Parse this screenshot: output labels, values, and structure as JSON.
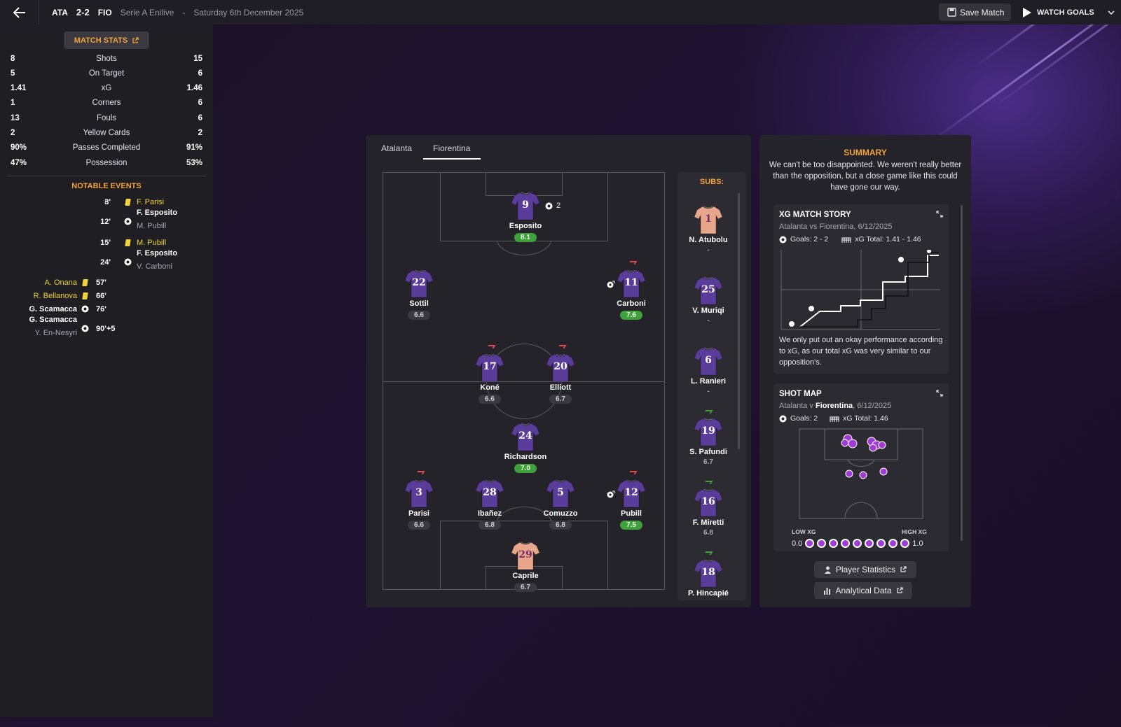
{
  "topbar": {
    "home": "ATA",
    "score": "2-2",
    "away": "FIO",
    "competition": "Serie A Enilive",
    "separator": "-",
    "date": "Saturday 6th December 2025",
    "save_label": "Save Match",
    "watch_label": "WATCH GOALS"
  },
  "match_stats": {
    "title": "MATCH STATS",
    "rows": [
      {
        "home": "8",
        "label": "Shots",
        "away": "15"
      },
      {
        "home": "5",
        "label": "On Target",
        "away": "6"
      },
      {
        "home": "1.41",
        "label": "xG",
        "away": "1.46"
      },
      {
        "home": "1",
        "label": "Corners",
        "away": "6"
      },
      {
        "home": "13",
        "label": "Fouls",
        "away": "6"
      },
      {
        "home": "2",
        "label": "Yellow Cards",
        "away": "2"
      },
      {
        "home": "90%",
        "label": "Passes Completed",
        "away": "91%"
      },
      {
        "home": "47%",
        "label": "Possession",
        "away": "53%"
      }
    ]
  },
  "notable": {
    "title": "NOTABLE EVENTS",
    "events": [
      {
        "min": "8'",
        "name": "F. Parisi"
      },
      {
        "min": "12'",
        "name": "F. Esposito",
        "assist": "M. Pubill"
      },
      {
        "min": "15'",
        "name": "M. Pubill"
      },
      {
        "min": "24'",
        "name": "F. Esposito",
        "assist": "V. Carboni"
      },
      {
        "min": "57'",
        "name": "A. Onana"
      },
      {
        "min": "66'",
        "name": "R. Bellanova"
      },
      {
        "min": "76'",
        "name": "G. Scamacca"
      },
      {
        "min": "90'+5",
        "name": "G. Scamacca",
        "assist": "Y. En-Nesyri"
      }
    ]
  },
  "lineup": {
    "tabs": [
      "Atalanta",
      "Fiorentina"
    ],
    "active_tab": "Fiorentina",
    "players": [
      {
        "num": "9",
        "name": "Esposito",
        "rating": "8.1",
        "good": true,
        "goals": "2"
      },
      {
        "num": "22",
        "name": "Sottil",
        "rating": "6.6",
        "good": false
      },
      {
        "num": "11",
        "name": "Carboni",
        "rating": "7.6",
        "good": true
      },
      {
        "num": "17",
        "name": "Koné",
        "rating": "6.6",
        "good": false
      },
      {
        "num": "20",
        "name": "Elliott",
        "rating": "6.7",
        "good": false
      },
      {
        "num": "24",
        "name": "Richardson",
        "rating": "7.0",
        "good": true
      },
      {
        "num": "3",
        "name": "Parisi",
        "rating": "6.6",
        "good": false
      },
      {
        "num": "28",
        "name": "Ibañez",
        "rating": "6.8",
        "good": false
      },
      {
        "num": "5",
        "name": "Comuzzo",
        "rating": "6.8",
        "good": false
      },
      {
        "num": "12",
        "name": "Pubill",
        "rating": "7.5",
        "good": true
      },
      {
        "num": "29",
        "name": "Caprile",
        "rating": "6.7",
        "good": false
      }
    ],
    "subs_title": "SUBS:",
    "subs": [
      {
        "num": "1",
        "name": "N. Atubolu",
        "rating": "-"
      },
      {
        "num": "25",
        "name": "V. Muriqi",
        "rating": "-"
      },
      {
        "num": "6",
        "name": "L. Ranieri",
        "rating": "-"
      },
      {
        "num": "19",
        "name": "S. Pafundi",
        "rating": "6.7"
      },
      {
        "num": "16",
        "name": "F. Miretti",
        "rating": "6.8"
      },
      {
        "num": "18",
        "name": "P. Hincapié",
        "rating": ""
      }
    ]
  },
  "summary": {
    "title": "SUMMARY",
    "text": "We can't be too disappointed. We weren't really better than the opposition, but a close game like this could have gone our way."
  },
  "xg_story": {
    "title": "XG MATCH STORY",
    "subtitle": "Atalanta vs Fiorentina, 6/12/2025",
    "goals": "Goals: 2 - 2",
    "xg_total": "xG Total: 1.41 - 1.46",
    "text": "We only put out an okay performance according to xG, as our total xG was very similar to our opposition's."
  },
  "shot_map": {
    "title": "SHOT MAP",
    "subtitle_pre": "Atalanta v",
    "subtitle_team": "Fiorentina",
    "subtitle_post": ", 6/12/2025",
    "goals": "Goals: 2",
    "xg_total": "xG Total: 1.46",
    "low": "LOW XG",
    "high": "HIGH XG",
    "min": "0.0",
    "max": "1.0"
  },
  "buttons": {
    "player_stats": "Player Statistics",
    "analytical": "Analytical Data"
  },
  "colors": {
    "accent": "#f2a33a",
    "rating_good": "#3fa13a",
    "shirt": "#5a3d9a",
    "keeper": "#e8a68a",
    "yellow": "#f0d23a"
  }
}
